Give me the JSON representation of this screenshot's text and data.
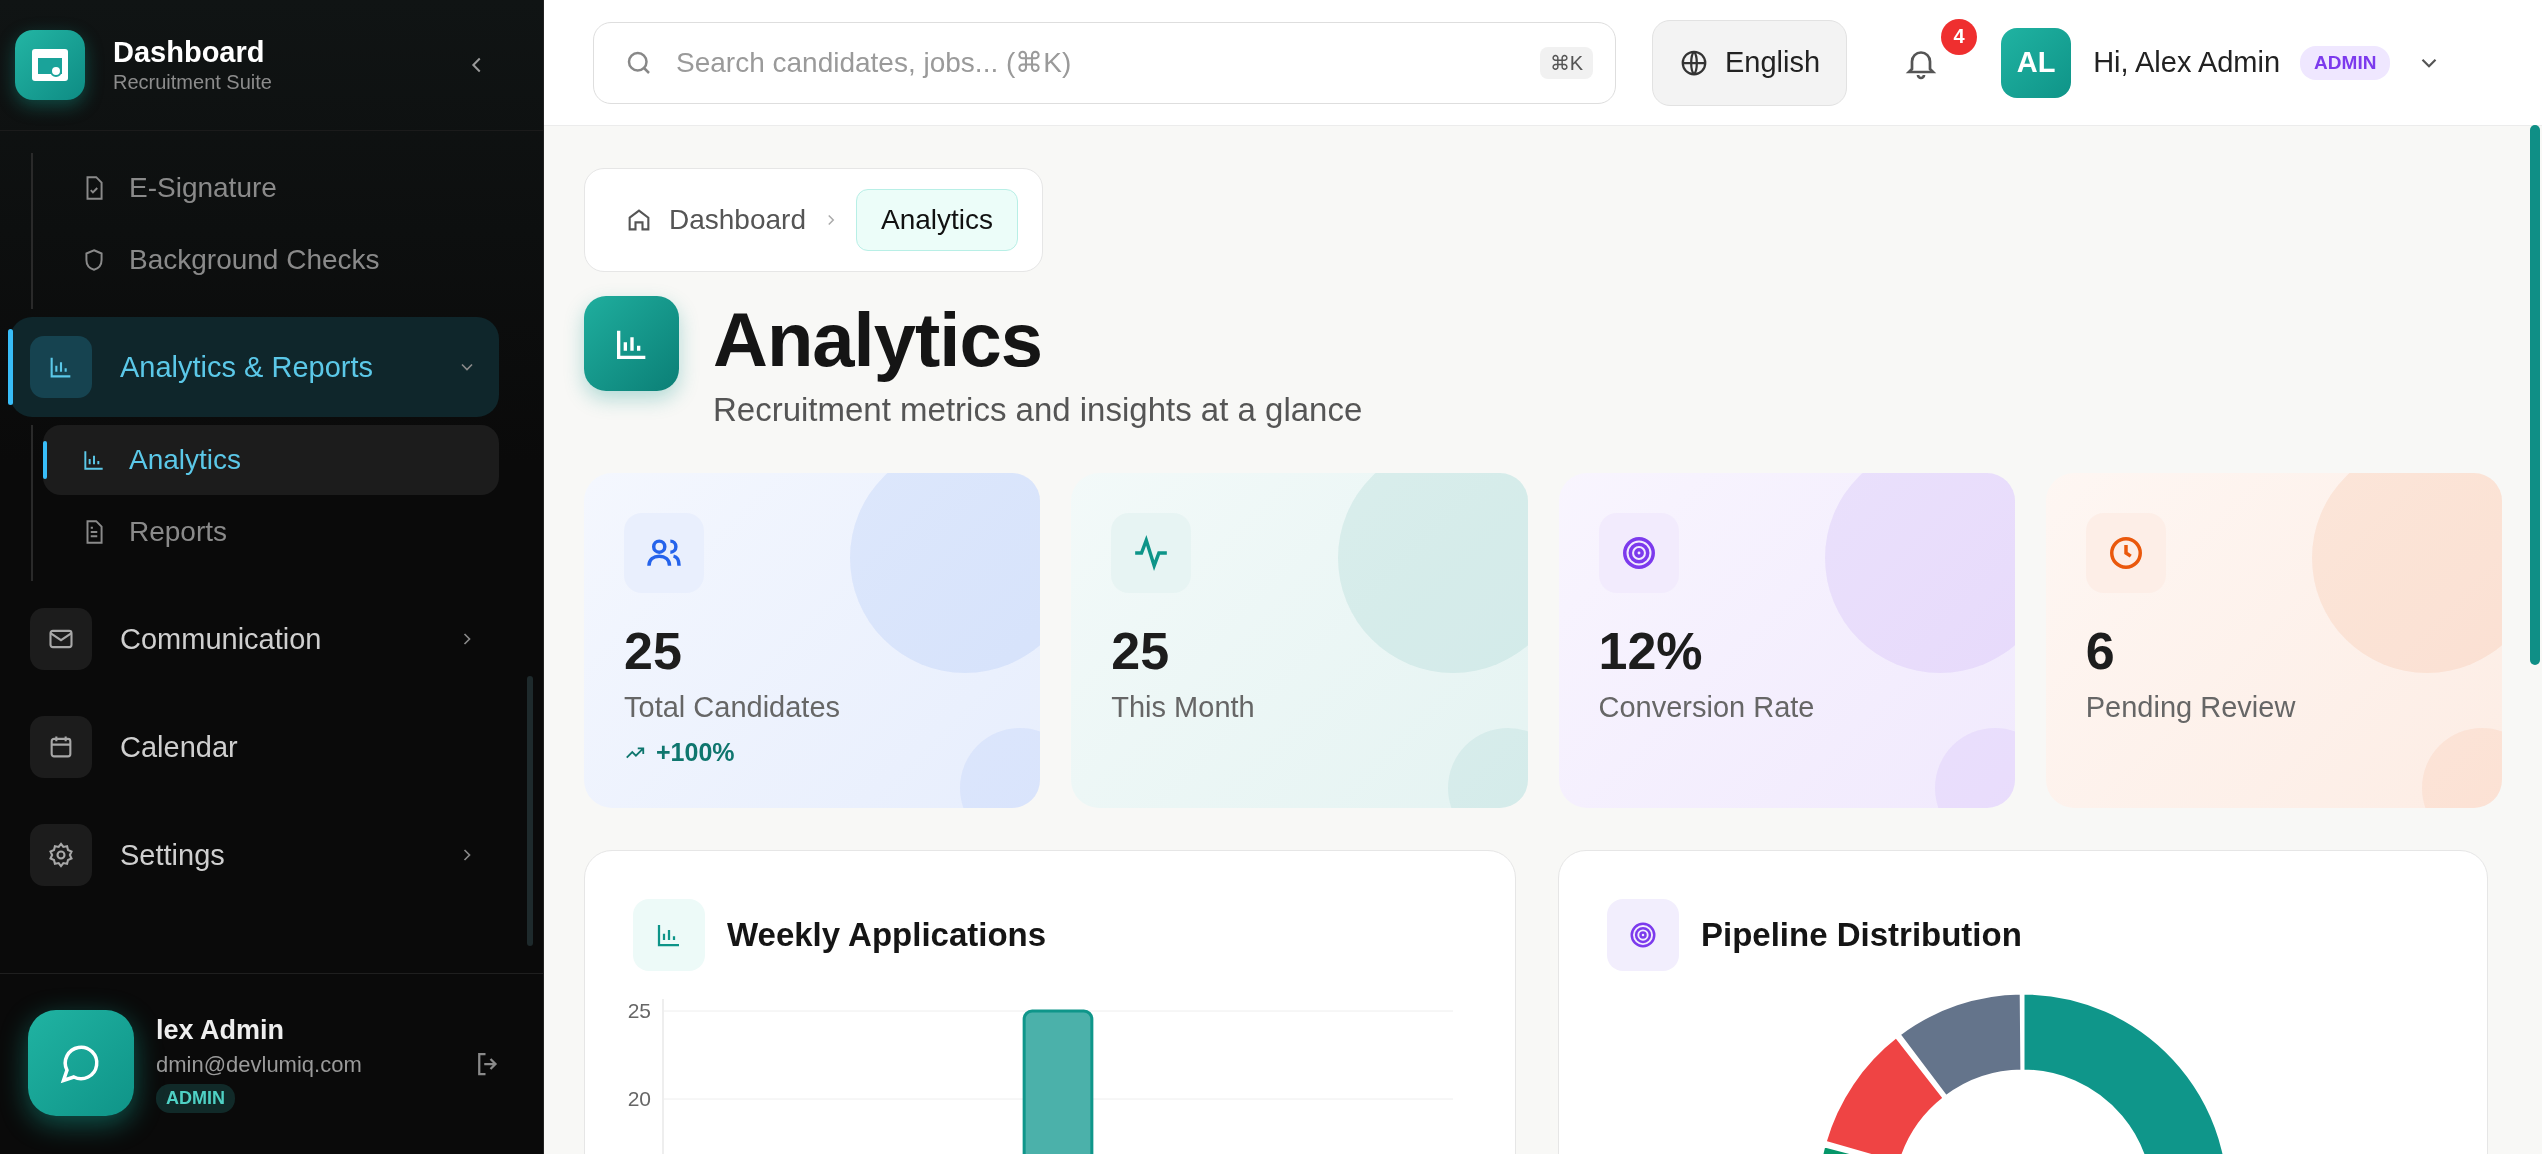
{
  "sidebar": {
    "brand": {
      "title": "Dashboard",
      "subtitle": "Recruitment Suite"
    },
    "nav": [
      {
        "kind": "child",
        "label": "E-Signature",
        "selected": false
      },
      {
        "kind": "child",
        "label": "Background Checks",
        "selected": false
      },
      {
        "kind": "group",
        "label": "Analytics & Reports",
        "selected": true,
        "expanded": true,
        "children": [
          {
            "label": "Analytics",
            "selected": true
          },
          {
            "label": "Reports",
            "selected": false
          }
        ]
      },
      {
        "kind": "group",
        "label": "Communication",
        "selected": false,
        "expanded": false
      },
      {
        "kind": "link",
        "label": "Calendar",
        "selected": false
      },
      {
        "kind": "group",
        "label": "Settings",
        "selected": false,
        "expanded": false
      }
    ],
    "user": {
      "name": "lex Admin",
      "email": "dmin@devlumiq.com",
      "role": "ADMIN"
    }
  },
  "topbar": {
    "search": {
      "placeholder": "Search candidates, jobs... (⌘K)",
      "shortcut": "⌘K"
    },
    "language": "English",
    "notifications": "4",
    "user": {
      "initials": "AL",
      "greeting": "Hi, Alex Admin",
      "role": "ADMIN"
    }
  },
  "breadcrumb": [
    {
      "label": "Dashboard",
      "selected": false
    },
    {
      "label": "Analytics",
      "selected": true
    }
  ],
  "page": {
    "title": "Analytics",
    "subtitle": "Recruitment metrics and insights at a glance"
  },
  "stats": [
    {
      "value": "25",
      "label": "Total Candidates",
      "trend": "+100%",
      "color": "#2563eb"
    },
    {
      "value": "25",
      "label": "This Month",
      "color": "#0d9488"
    },
    {
      "value": "12%",
      "label": "Conversion Rate",
      "color": "#7c3aed"
    },
    {
      "value": "6",
      "label": "Pending Review",
      "color": "#ea580c"
    }
  ],
  "weekly_chart": {
    "title": "Weekly Applications",
    "chart_data": {
      "type": "bar",
      "values": [
        null,
        null,
        null,
        25,
        null,
        null,
        null
      ],
      "ylim": [
        0,
        25
      ],
      "yticks": [
        20,
        25
      ]
    }
  },
  "pipeline_chart": {
    "title": "Pipeline Distribution"
  }
}
